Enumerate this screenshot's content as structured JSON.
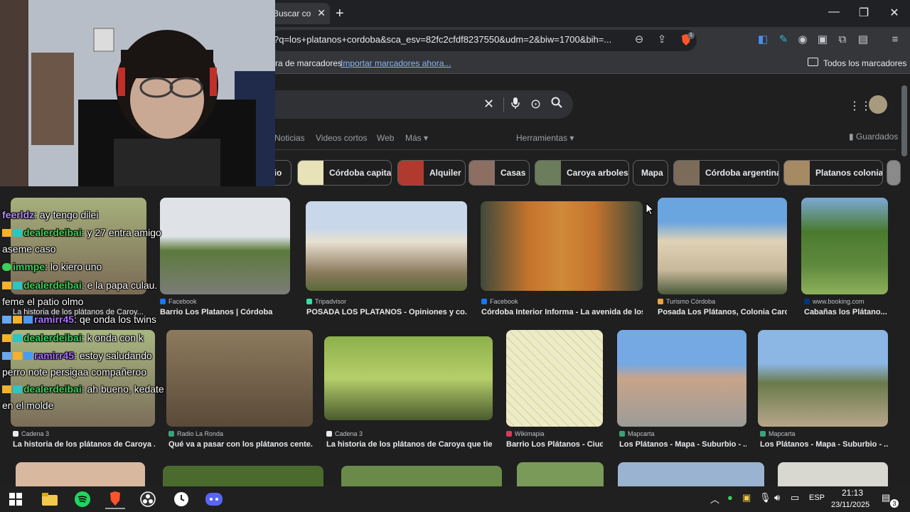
{
  "browser": {
    "tab_title": "Buscar co",
    "url": "?q=los+platanos+cordoba&sca_esv=82fc2cfdf8237550&udm=2&biw=1700&bih=...",
    "brave_badge": "1",
    "bookmarks_prefix": "ra de marcadores",
    "bookmarks_import": "Importar marcadores ahora...",
    "bookmarks_all": "Todos los marcadores"
  },
  "google": {
    "nav_tabs": [
      "Noticias",
      "Videos cortos",
      "Web",
      "Más"
    ],
    "tools": "Herramientas",
    "saved": "Guardados",
    "chips": [
      {
        "label": "rio",
        "color": "#6d7a86"
      },
      {
        "label": "Córdoba capital",
        "color": "#e8e2b8"
      },
      {
        "label": "Alquiler",
        "color": "#b03a2e"
      },
      {
        "label": "Casas",
        "color": "#8d6e63"
      },
      {
        "label": "Caroya arboles",
        "color": "#6b7d5a"
      },
      {
        "label": "Mapa",
        "color": ""
      },
      {
        "label": "Córdoba argentina",
        "color": "#7d6b5a"
      },
      {
        "label": "Platanos colonia",
        "color": "#a68a64"
      }
    ],
    "row1": [
      {
        "source": "",
        "title": "La historia de los plátanos de Caroy...",
        "color1": "#a6b07c",
        "color2": "#7a6a55"
      },
      {
        "source": "Facebook",
        "title": "Barrio Los Platanos | Córdoba",
        "color1": "#dfe3e8",
        "color2": "#7b7d78"
      },
      {
        "source": "Tripadvisor",
        "title": "POSADA LOS PLATANOS - Opiniones y co...",
        "color1": "#c8d8ea",
        "color2": "#8a7a5c"
      },
      {
        "source": "Facebook",
        "title": "Córdoba Interior Informa - La avenida de los...",
        "color1": "#c5742d",
        "color2": "#3f4a3a"
      },
      {
        "source": "Turismo Córdoba",
        "title": "Posada Los Plátanos, Colonia Caro...",
        "color1": "#6aa5df",
        "color2": "#e0d2b6"
      },
      {
        "source": "www.booking.com",
        "title": "Cabañas los Plátano...",
        "color1": "#7ba9d6",
        "color2": "#5f8a3e"
      }
    ],
    "row2": [
      {
        "source": "Cadena 3",
        "title": "La historia de los plátanos de Caroya ...",
        "color1": "#a8b780",
        "color2": "#7b6d5a"
      },
      {
        "source": "Radio La Ronda",
        "title": "Qué va a pasar con los plátanos cente...",
        "color1": "#8d7a5e",
        "color2": "#5a4a38"
      },
      {
        "source": "Cadena 3",
        "title": "La historia de los plátanos de Caroya que tie...",
        "color1": "#8db04a",
        "color2": "#4a5a2e"
      },
      {
        "source": "Wikimapia",
        "title": "Barrio Los Plátanos - Ciud...",
        "color1": "#ecebc8",
        "color2": "#d6d08c"
      },
      {
        "source": "Mapcarta",
        "title": "Los Plátanos - Mapa - Suburbio - ...",
        "color1": "#74a9e3",
        "color2": "#9c9c98"
      },
      {
        "source": "Mapcarta",
        "title": "Los Plátanos - Mapa - Suburbio - ...",
        "color1": "#8cb6e3",
        "color2": "#b8a68a"
      }
    ]
  },
  "chat": [
    {
      "user": "feerldz",
      "user_color": "#b18cf5",
      "message": ": ay tengo dilei",
      "badges": []
    },
    {
      "user": "dealerdeibai",
      "user_color": "#3bd15a",
      "message": ": y 27 entra amigo",
      "badges": [
        "crown",
        "bits"
      ]
    },
    {
      "user": "",
      "user_color": "",
      "message": "aseme caso",
      "badges": []
    },
    {
      "user": "immpe",
      "user_color": "#3bd15a",
      "message": ": lo kiero uno",
      "badges": [
        "leaf"
      ]
    },
    {
      "user": "dealerdeibai",
      "user_color": "#3bd15a",
      "message": ": e la papa culau.",
      "badges": [
        "crown",
        "bits"
      ]
    },
    {
      "user": "",
      "user_color": "",
      "message": "feme el patio olmo",
      "badges": []
    },
    {
      "user": "ramirr45",
      "user_color": "#a970ff",
      "message": ": qe onda los twins",
      "badges": [
        "sword",
        "crown",
        "gem"
      ]
    },
    {
      "user": "dealerdeibai",
      "user_color": "#3bd15a",
      "message": ": k onda con k",
      "badges": [
        "crown",
        "bits"
      ]
    },
    {
      "user": "ramirr45",
      "user_color": "#a970ff",
      "message": ": estoy saludando",
      "badges": [
        "sword",
        "crown",
        "gem"
      ]
    },
    {
      "user": "",
      "user_color": "",
      "message": "perro note persigaa compañeroo",
      "badges": []
    },
    {
      "user": "dealerdeibai",
      "user_color": "#3bd15a",
      "message": ": ah bueno, kedate",
      "badges": [
        "crown",
        "bits"
      ]
    },
    {
      "user": "",
      "user_color": "",
      "message": "en el molde",
      "badges": []
    }
  ],
  "taskbar": {
    "time": "21:13",
    "date": "23/11/2025",
    "language": "ESP",
    "notifications": "3"
  }
}
